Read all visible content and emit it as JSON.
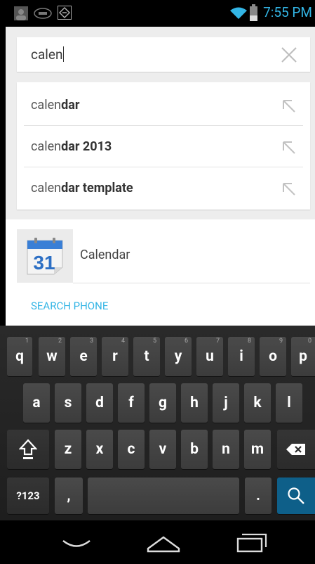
{
  "status_bar": {
    "time": "7:55 PM",
    "left_icons": [
      "avatar-icon",
      "intel-icon",
      "media-icon"
    ],
    "right_icons": [
      "wifi-icon",
      "battery-icon"
    ],
    "accent_color": "#33b5e5"
  },
  "search": {
    "query": "calen",
    "clear_icon": "close-icon"
  },
  "suggestions": [
    {
      "typed": "calen",
      "completion": "dar"
    },
    {
      "typed": "calen",
      "completion": "dar 2013"
    },
    {
      "typed": "calen",
      "completion": "dar template"
    }
  ],
  "results": {
    "app_icon_day": "31",
    "app_label": "Calendar",
    "search_phone_label": "SEARCH PHONE"
  },
  "keyboard": {
    "row1": [
      {
        "label": "q",
        "hint": "1"
      },
      {
        "label": "w",
        "hint": "2"
      },
      {
        "label": "e",
        "hint": "3"
      },
      {
        "label": "r",
        "hint": "4"
      },
      {
        "label": "t",
        "hint": "5"
      },
      {
        "label": "y",
        "hint": "6"
      },
      {
        "label": "u",
        "hint": "7"
      },
      {
        "label": "i",
        "hint": "8"
      },
      {
        "label": "o",
        "hint": "9"
      },
      {
        "label": "p",
        "hint": "0"
      }
    ],
    "row2": [
      "a",
      "s",
      "d",
      "f",
      "g",
      "h",
      "j",
      "k",
      "l"
    ],
    "row3": [
      "z",
      "x",
      "c",
      "v",
      "b",
      "n",
      "m"
    ],
    "symbols_label": "?123",
    "comma_label": ",",
    "period_label": ".",
    "shift_icon": "shift-icon",
    "backspace_icon": "backspace-icon",
    "search_icon": "search-icon",
    "action_key_color": "#0e5f89"
  },
  "nav_bar": {
    "icons": [
      "back-icon",
      "home-icon",
      "recent-apps-icon"
    ]
  }
}
